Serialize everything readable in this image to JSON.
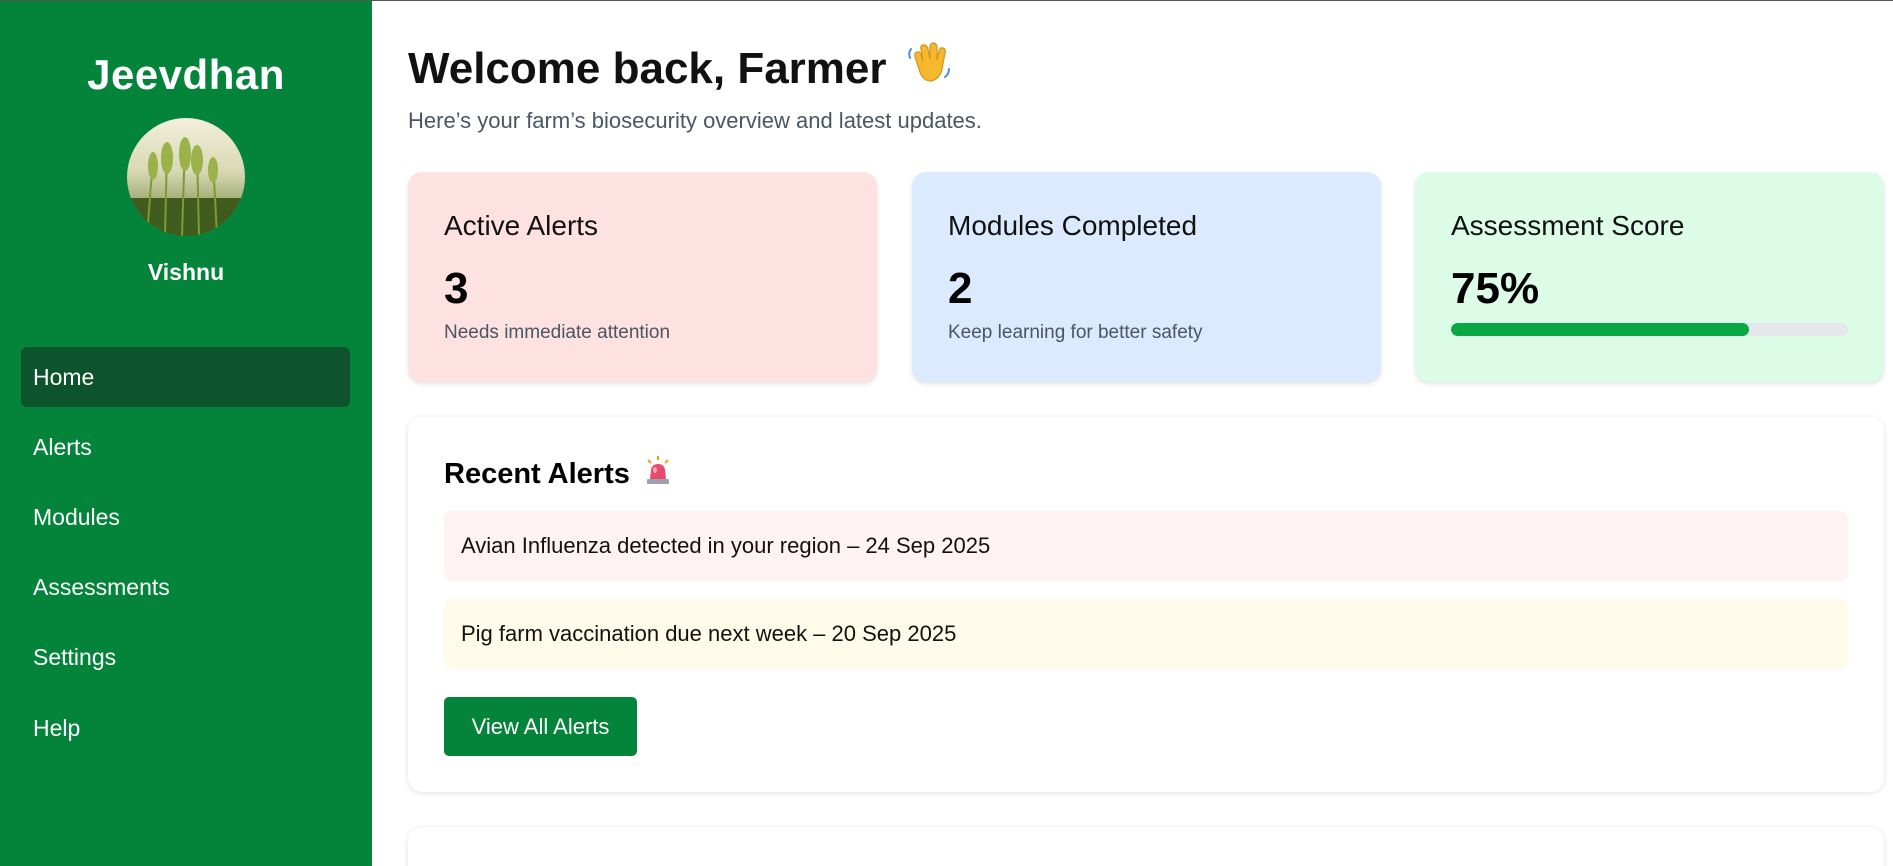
{
  "sidebar": {
    "brand": "Jeevdhan",
    "username": "Vishnu",
    "items": [
      {
        "label": "Home",
        "active": true
      },
      {
        "label": "Alerts"
      },
      {
        "label": "Modules"
      },
      {
        "label": "Assessments"
      },
      {
        "label": "Settings"
      },
      {
        "label": "Help"
      }
    ]
  },
  "header": {
    "title": "Welcome back, Farmer",
    "icon": "waving-hand-icon",
    "subtitle": "Here’s your farm’s biosecurity overview and latest updates."
  },
  "cards": [
    {
      "title": "Active Alerts",
      "value": "3",
      "note": "Needs immediate attention",
      "bg": "#fee2e2"
    },
    {
      "title": "Modules Completed",
      "value": "2",
      "note": "Keep learning for better safety",
      "bg": "#dbeafe"
    },
    {
      "title": "Assessment Score",
      "value": "75%",
      "progress": 0.75,
      "bg": "#dcfce7"
    }
  ],
  "recent_alerts": {
    "title": "Recent Alerts",
    "icon": "siren-icon",
    "items": [
      {
        "text": "Avian Influenza detected in your region – 24 Sep 2025",
        "bg": "#fef2f2"
      },
      {
        "text": "Pig farm vaccination due next week – 20 Sep 2025",
        "bg": "#fefce8"
      }
    ],
    "button_label": "View All Alerts"
  },
  "colors": {
    "sidebar": "#03843a",
    "sidebar_active": "#0d532b",
    "progress": "#0aa845"
  }
}
